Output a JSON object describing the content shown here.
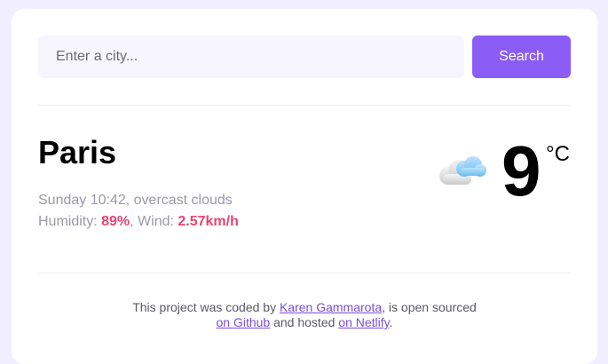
{
  "search": {
    "placeholder": "Enter a city...",
    "button_label": "Search"
  },
  "weather": {
    "city": "Paris",
    "datetime_description": "Sunday 10:42, overcast clouds",
    "humidity_label": "Humidity: ",
    "humidity_value": "89%",
    "wind_label": ", Wind: ",
    "wind_value": "2.57km/h",
    "temperature": "9",
    "unit": "°C",
    "icon": "overcast-cloud-icon"
  },
  "footer": {
    "text_1": "This project was coded by ",
    "author_link": "Karen Gammarota",
    "text_2": ", is open sourced",
    "github_link": "on Github",
    "text_3": " and hosted ",
    "netlify_link": "on Netlify",
    "text_4": "."
  },
  "colors": {
    "accent": "#8b5cf6",
    "highlight": "#e8456f",
    "background": "#f1efff"
  }
}
